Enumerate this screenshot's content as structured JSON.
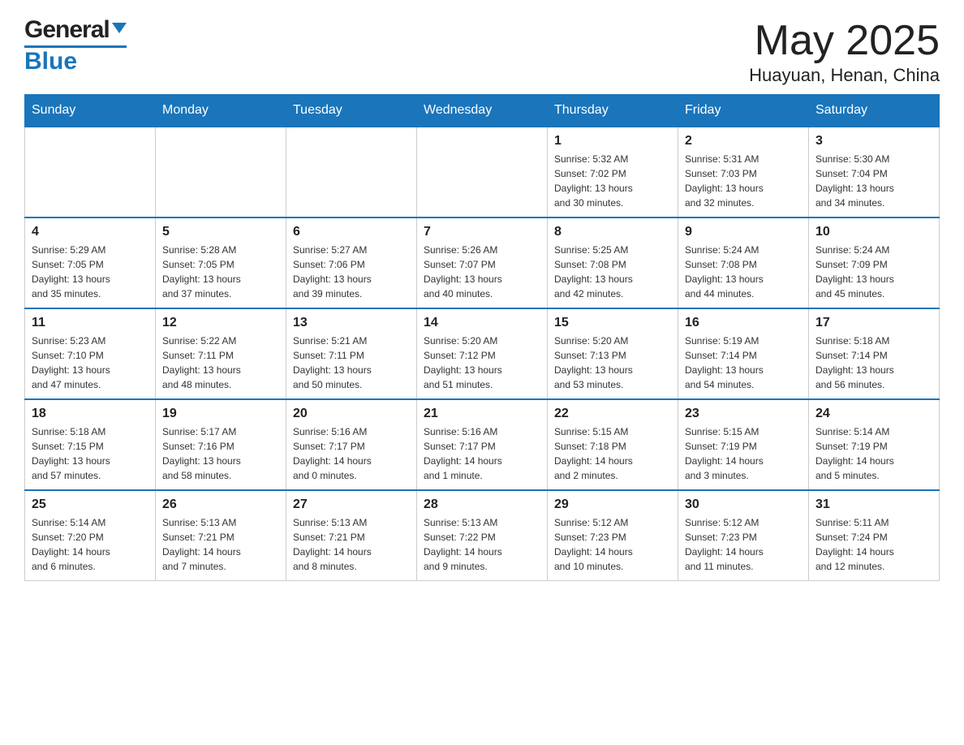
{
  "header": {
    "logo_general": "General",
    "logo_blue": "Blue",
    "title": "May 2025",
    "subtitle": "Huayuan, Henan, China"
  },
  "weekdays": [
    "Sunday",
    "Monday",
    "Tuesday",
    "Wednesday",
    "Thursday",
    "Friday",
    "Saturday"
  ],
  "weeks": [
    [
      {
        "day": "",
        "info": ""
      },
      {
        "day": "",
        "info": ""
      },
      {
        "day": "",
        "info": ""
      },
      {
        "day": "",
        "info": ""
      },
      {
        "day": "1",
        "info": "Sunrise: 5:32 AM\nSunset: 7:02 PM\nDaylight: 13 hours\nand 30 minutes."
      },
      {
        "day": "2",
        "info": "Sunrise: 5:31 AM\nSunset: 7:03 PM\nDaylight: 13 hours\nand 32 minutes."
      },
      {
        "day": "3",
        "info": "Sunrise: 5:30 AM\nSunset: 7:04 PM\nDaylight: 13 hours\nand 34 minutes."
      }
    ],
    [
      {
        "day": "4",
        "info": "Sunrise: 5:29 AM\nSunset: 7:05 PM\nDaylight: 13 hours\nand 35 minutes."
      },
      {
        "day": "5",
        "info": "Sunrise: 5:28 AM\nSunset: 7:05 PM\nDaylight: 13 hours\nand 37 minutes."
      },
      {
        "day": "6",
        "info": "Sunrise: 5:27 AM\nSunset: 7:06 PM\nDaylight: 13 hours\nand 39 minutes."
      },
      {
        "day": "7",
        "info": "Sunrise: 5:26 AM\nSunset: 7:07 PM\nDaylight: 13 hours\nand 40 minutes."
      },
      {
        "day": "8",
        "info": "Sunrise: 5:25 AM\nSunset: 7:08 PM\nDaylight: 13 hours\nand 42 minutes."
      },
      {
        "day": "9",
        "info": "Sunrise: 5:24 AM\nSunset: 7:08 PM\nDaylight: 13 hours\nand 44 minutes."
      },
      {
        "day": "10",
        "info": "Sunrise: 5:24 AM\nSunset: 7:09 PM\nDaylight: 13 hours\nand 45 minutes."
      }
    ],
    [
      {
        "day": "11",
        "info": "Sunrise: 5:23 AM\nSunset: 7:10 PM\nDaylight: 13 hours\nand 47 minutes."
      },
      {
        "day": "12",
        "info": "Sunrise: 5:22 AM\nSunset: 7:11 PM\nDaylight: 13 hours\nand 48 minutes."
      },
      {
        "day": "13",
        "info": "Sunrise: 5:21 AM\nSunset: 7:11 PM\nDaylight: 13 hours\nand 50 minutes."
      },
      {
        "day": "14",
        "info": "Sunrise: 5:20 AM\nSunset: 7:12 PM\nDaylight: 13 hours\nand 51 minutes."
      },
      {
        "day": "15",
        "info": "Sunrise: 5:20 AM\nSunset: 7:13 PM\nDaylight: 13 hours\nand 53 minutes."
      },
      {
        "day": "16",
        "info": "Sunrise: 5:19 AM\nSunset: 7:14 PM\nDaylight: 13 hours\nand 54 minutes."
      },
      {
        "day": "17",
        "info": "Sunrise: 5:18 AM\nSunset: 7:14 PM\nDaylight: 13 hours\nand 56 minutes."
      }
    ],
    [
      {
        "day": "18",
        "info": "Sunrise: 5:18 AM\nSunset: 7:15 PM\nDaylight: 13 hours\nand 57 minutes."
      },
      {
        "day": "19",
        "info": "Sunrise: 5:17 AM\nSunset: 7:16 PM\nDaylight: 13 hours\nand 58 minutes."
      },
      {
        "day": "20",
        "info": "Sunrise: 5:16 AM\nSunset: 7:17 PM\nDaylight: 14 hours\nand 0 minutes."
      },
      {
        "day": "21",
        "info": "Sunrise: 5:16 AM\nSunset: 7:17 PM\nDaylight: 14 hours\nand 1 minute."
      },
      {
        "day": "22",
        "info": "Sunrise: 5:15 AM\nSunset: 7:18 PM\nDaylight: 14 hours\nand 2 minutes."
      },
      {
        "day": "23",
        "info": "Sunrise: 5:15 AM\nSunset: 7:19 PM\nDaylight: 14 hours\nand 3 minutes."
      },
      {
        "day": "24",
        "info": "Sunrise: 5:14 AM\nSunset: 7:19 PM\nDaylight: 14 hours\nand 5 minutes."
      }
    ],
    [
      {
        "day": "25",
        "info": "Sunrise: 5:14 AM\nSunset: 7:20 PM\nDaylight: 14 hours\nand 6 minutes."
      },
      {
        "day": "26",
        "info": "Sunrise: 5:13 AM\nSunset: 7:21 PM\nDaylight: 14 hours\nand 7 minutes."
      },
      {
        "day": "27",
        "info": "Sunrise: 5:13 AM\nSunset: 7:21 PM\nDaylight: 14 hours\nand 8 minutes."
      },
      {
        "day": "28",
        "info": "Sunrise: 5:13 AM\nSunset: 7:22 PM\nDaylight: 14 hours\nand 9 minutes."
      },
      {
        "day": "29",
        "info": "Sunrise: 5:12 AM\nSunset: 7:23 PM\nDaylight: 14 hours\nand 10 minutes."
      },
      {
        "day": "30",
        "info": "Sunrise: 5:12 AM\nSunset: 7:23 PM\nDaylight: 14 hours\nand 11 minutes."
      },
      {
        "day": "31",
        "info": "Sunrise: 5:11 AM\nSunset: 7:24 PM\nDaylight: 14 hours\nand 12 minutes."
      }
    ]
  ]
}
